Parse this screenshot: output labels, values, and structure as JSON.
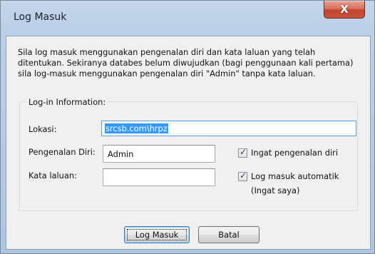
{
  "window": {
    "title": "Log Masuk",
    "close_label": "X"
  },
  "intro": {
    "line1": "Sila log masuk menggunakan pengenalan diri dan kata laluan yang telah",
    "line2": "ditentukan. Sekiranya databes belum diwujudkan (bagi penggunaan kali pertama)",
    "line3": "sila log-masuk menggunakan pengenalan diri \"Admin\" tanpa kata laluan."
  },
  "group": {
    "label": "Log-in Information:"
  },
  "fields": {
    "location": {
      "label": "Lokasi:",
      "value": "srcsb.com\\hrpz"
    },
    "user_id": {
      "label": "Pengenalan Diri:",
      "value": "Admin"
    },
    "password": {
      "label": "Kata laluan:",
      "value": ""
    }
  },
  "checkboxes": {
    "remember_id": {
      "label": "Ingat pengenalan diri",
      "checked": true
    },
    "auto_login": {
      "label": "Log masuk automatik",
      "sublabel": "(Ingat saya)",
      "checked": true
    }
  },
  "buttons": {
    "login": "Log Masuk",
    "cancel": "Batal"
  },
  "colors": {
    "title_bar": "#bcd0e7",
    "close_button": "#c24430",
    "selection": "#3399ff",
    "dialog_bg": "#f0f0f0"
  }
}
